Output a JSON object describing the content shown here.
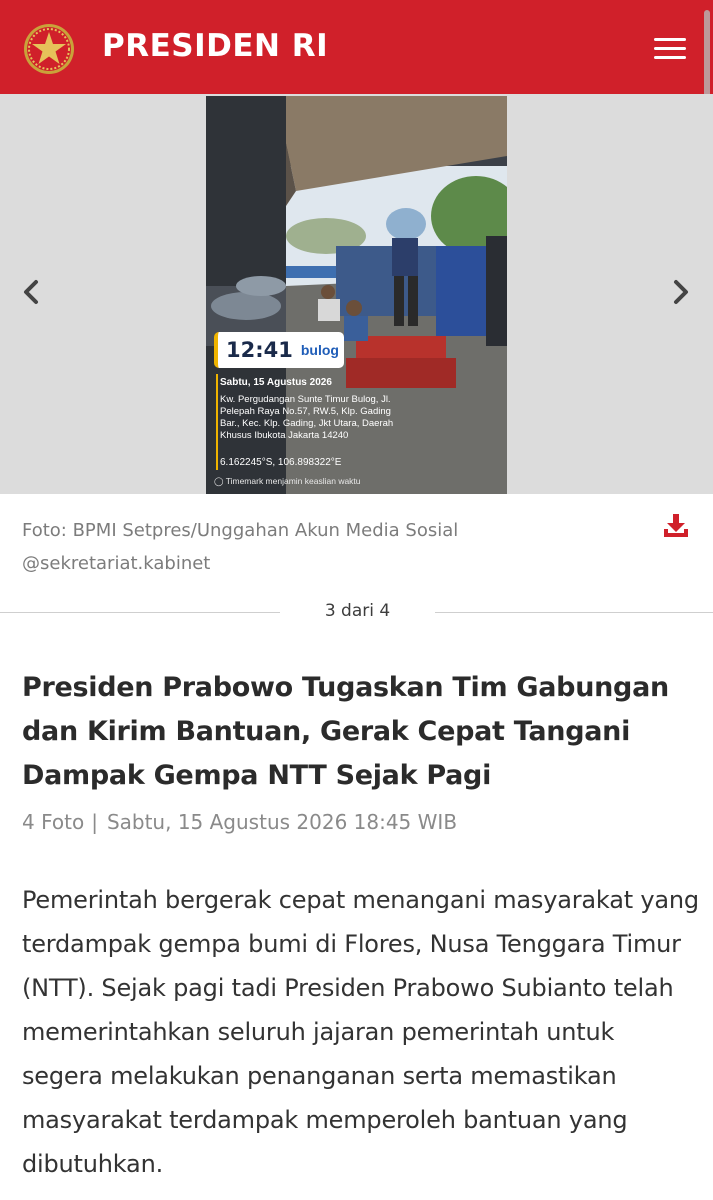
{
  "header": {
    "brand": "PRESIDEN RI",
    "icons": {
      "emblem": "garuda-emblem-icon",
      "menu": "hamburger-menu-icon"
    },
    "color": "#d0202a"
  },
  "carousel": {
    "icons": {
      "prev": "chevron-left-icon",
      "next": "chevron-right-icon"
    },
    "photo": {
      "stamp_time": "12:41",
      "stamp_logo": "bulog",
      "stamp_date": "Sabtu, 15 Agustus 2026",
      "stamp_address": "Kw. Pergudangan Sunte Timur Bulog, Jl. Pelepah Raya No.57, RW.5, Klp. Gading Bar., Kec. Klp. Gading, Jkt Utara, Daerah Khusus Ibukota Jakarta 14240",
      "stamp_coords": "6.162245°S, 106.898322°E",
      "stamp_verify": "Timemark menjamin keaslian waktu"
    }
  },
  "caption": {
    "text": "Foto: BPMI Setpres/Unggahan Akun Media Sosial @sekretariat.kabinet",
    "download_icon": "download-icon",
    "download_color": "#d0202a"
  },
  "counter": {
    "text": "3 dari 4",
    "current": 3,
    "total": 4
  },
  "article": {
    "title": "Presiden Prabowo Tugaskan Tim Gabungan dan Kirim Bantuan, Gerak Cepat Tangani Dampak Gempa NTT Sejak Pagi",
    "photo_count": "4 Foto",
    "separator": "|",
    "date": "Sabtu, 15 Agustus 2026 18:45 WIB",
    "body": "Pemerintah bergerak cepat menangani masyarakat yang terdampak gempa bumi di Flores, Nusa Tenggara Timur (NTT). Sejak pagi tadi Presiden Prabowo Subianto telah memerintahkan seluruh jajaran pemerintah untuk segera melakukan penanganan serta memastikan masyarakat terdampak memperoleh bantuan yang dibutuhkan."
  }
}
